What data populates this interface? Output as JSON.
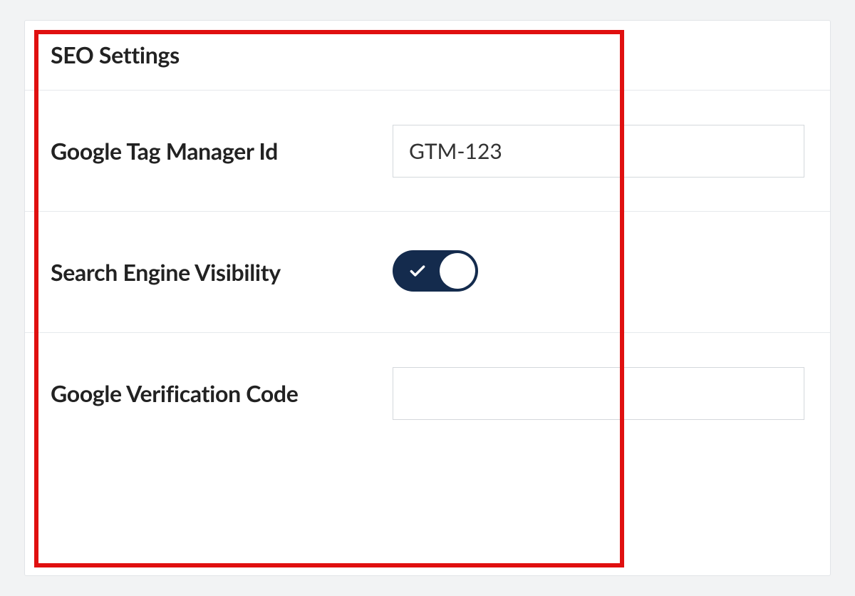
{
  "panel": {
    "title": "SEO Settings"
  },
  "fields": {
    "gtm": {
      "label": "Google Tag Manager Id",
      "value": "GTM-123"
    },
    "visibility": {
      "label": "Search Engine Visibility",
      "state": "on"
    },
    "verification": {
      "label": "Google Verification Code",
      "value": ""
    }
  },
  "highlight": {
    "color": "#e01010"
  }
}
